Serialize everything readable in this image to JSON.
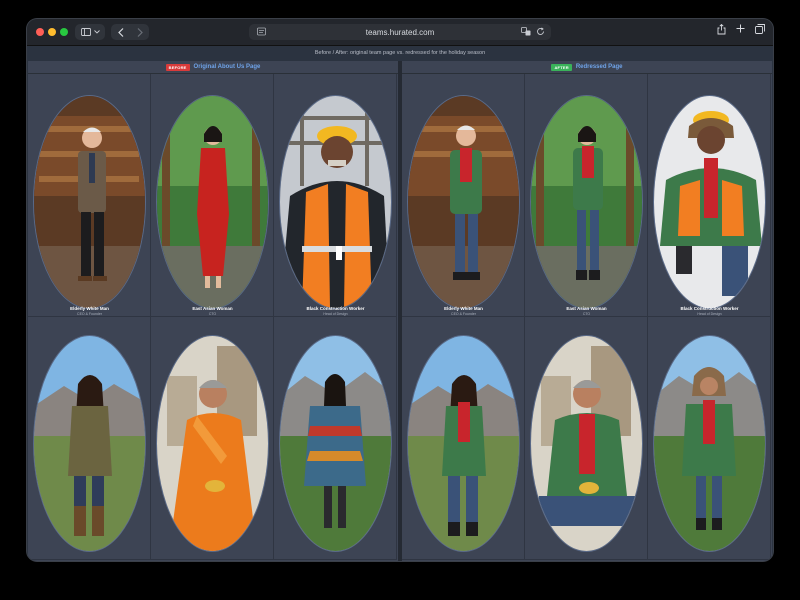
{
  "browser": {
    "url": "teams.hurated.com"
  },
  "caption": "Before / After: original team page vs. redressed for the holiday season",
  "before_panel": {
    "badge": "BEFORE",
    "title": "Original About Us Page",
    "people": [
      {
        "name": "Elderly White Man",
        "role": "CEO & Founder"
      },
      {
        "name": "East Asian Woman",
        "role": "CTO"
      },
      {
        "name": "Black Construction Worker",
        "role": "Head of Design"
      },
      {
        "name": "",
        "role": ""
      },
      {
        "name": "",
        "role": ""
      },
      {
        "name": "",
        "role": ""
      }
    ]
  },
  "after_panel": {
    "badge": "AFTER",
    "title": "Redressed Page",
    "people": [
      {
        "name": "Elderly White Man",
        "role": "CEO & Founder"
      },
      {
        "name": "East Asian Woman",
        "role": "CTO"
      },
      {
        "name": "Black Construction Worker",
        "role": "Head of Design"
      },
      {
        "name": "",
        "role": ""
      },
      {
        "name": "",
        "role": ""
      },
      {
        "name": "",
        "role": ""
      }
    ]
  },
  "colors": {
    "before_badge": "#d93b3b",
    "after_badge": "#3ab25a",
    "title_blue": "#6fa3e8",
    "holiday_scarf": "#c8252c",
    "holiday_jacket": "#3d7a4a"
  }
}
